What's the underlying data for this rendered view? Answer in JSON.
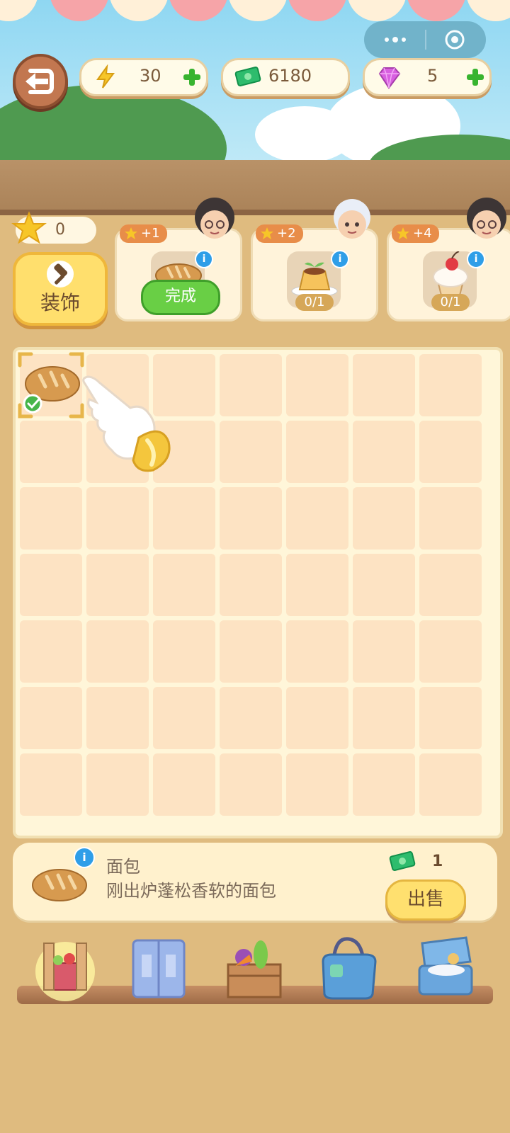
{
  "top_bar": {
    "energy_value": "30",
    "cash_value": "6180",
    "gems_value": "5"
  },
  "left_panel": {
    "stars_value": "0",
    "decor_label": "装饰"
  },
  "orders": [
    {
      "reward": "+1",
      "status": "完成",
      "item": "bread-icon"
    },
    {
      "reward": "+2",
      "progress": "0/1",
      "item": "pudding-icon"
    },
    {
      "reward": "+4",
      "progress": "0/1",
      "item": "cupcake-icon"
    }
  ],
  "board": {
    "rows": 7,
    "cols": 7,
    "filled": [
      {
        "row": 0,
        "col": 0,
        "item": "bread-icon",
        "selected": true
      }
    ]
  },
  "item_info": {
    "name": "面包",
    "description": "刚出炉蓬松香软的面包",
    "price": "1",
    "sell_label": "出售"
  },
  "bottom_tabs": [
    "market-stall-icon",
    "wardrobe-icon",
    "vegetable-crate-icon",
    "bag-icon",
    "suitcase-icon"
  ],
  "colors": {
    "board_cell": "#fde3c3",
    "accent_yellow": "#ffdf6d",
    "done_green": "#69cf45",
    "info_blue": "#2f9ee8"
  }
}
